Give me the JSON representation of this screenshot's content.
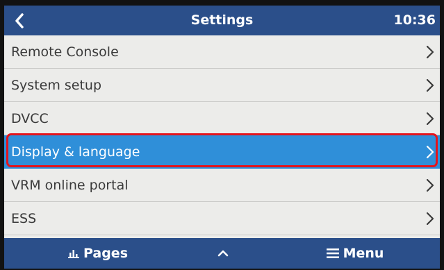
{
  "header": {
    "title": "Settings",
    "clock": "10:36",
    "back_icon": "chevron-left-icon"
  },
  "menu": {
    "items": [
      {
        "label": "Remote Console",
        "icon": "chevron-right-icon",
        "selected": false
      },
      {
        "label": "System setup",
        "icon": "chevron-right-icon",
        "selected": false
      },
      {
        "label": "DVCC",
        "icon": "chevron-right-icon",
        "selected": false
      },
      {
        "label": "Display & language",
        "icon": "chevron-right-icon",
        "selected": true
      },
      {
        "label": "VRM online portal",
        "icon": "chevron-right-icon",
        "selected": false
      },
      {
        "label": "ESS",
        "icon": "chevron-right-icon",
        "selected": false
      }
    ]
  },
  "footer": {
    "pages_label": "Pages",
    "pages_icon": "bar-chart-icon",
    "up_icon": "chevron-up-icon",
    "menu_label": "Menu",
    "menu_icon": "hamburger-icon"
  },
  "colors": {
    "header_bg": "#2b4f8a",
    "selected_bg": "#2f8fd9",
    "list_bg": "#ececea",
    "highlight_ring": "#e4141c"
  }
}
